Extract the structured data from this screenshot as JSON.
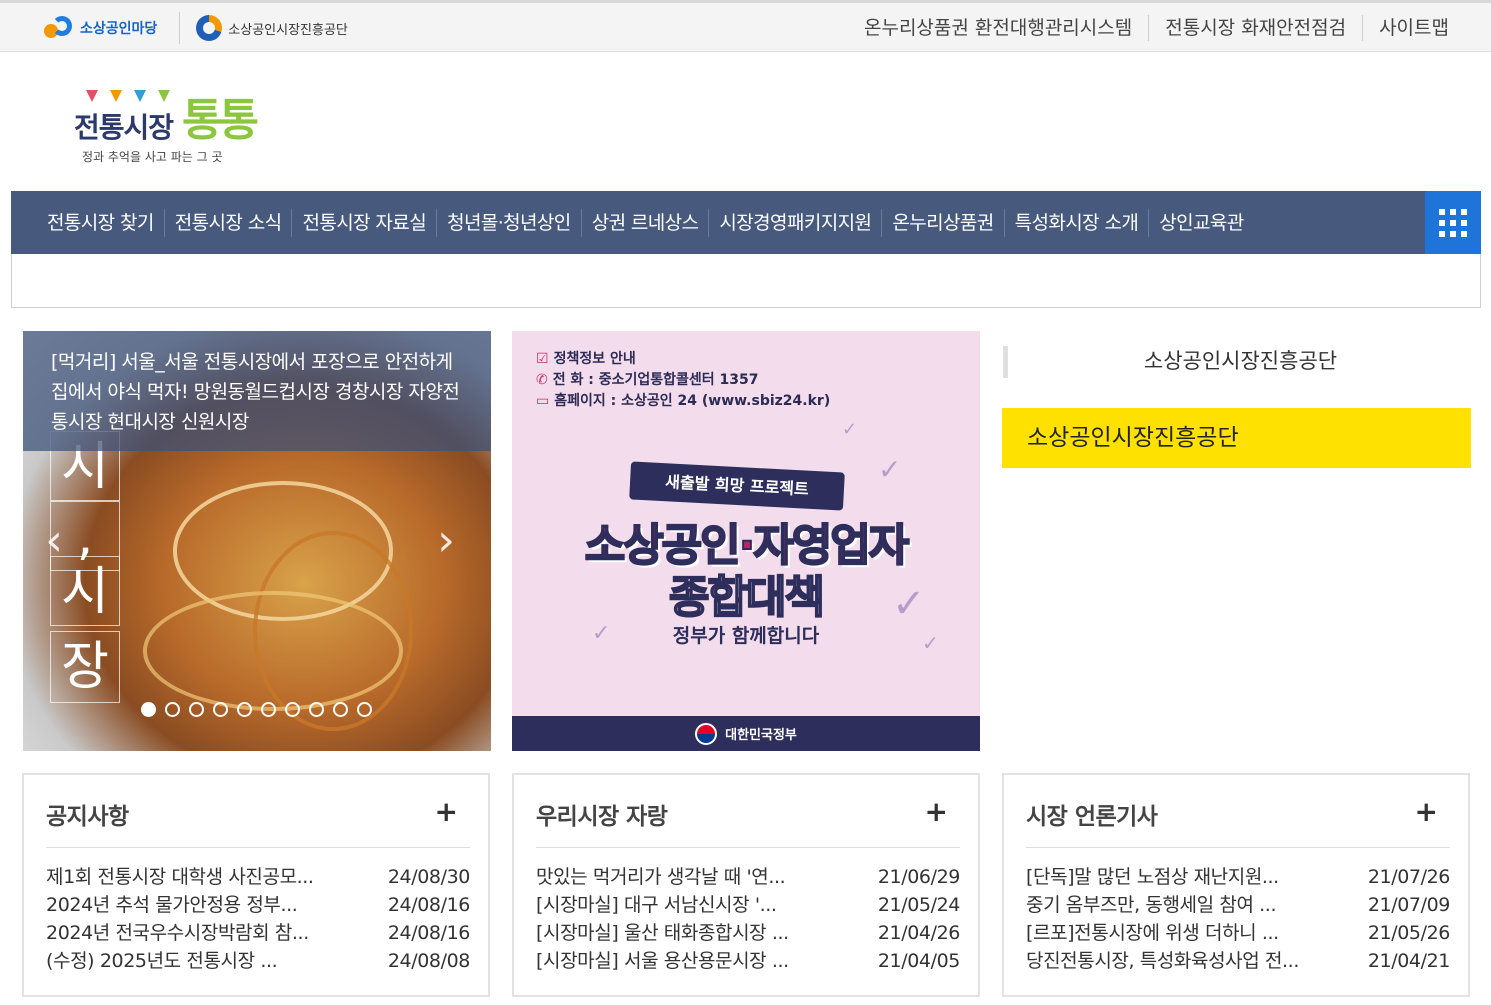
{
  "topbar": {
    "logo_a": "소상공인마당",
    "logo_b": "소상공인시장진흥공단",
    "links": [
      "온누리상품권 환전대행관리시스템",
      "전통시장 화재안전점검",
      "사이트맵"
    ]
  },
  "logo": {
    "title": "전통시장",
    "tong": "통통",
    "subtitle": "정과 추억을 사고 파는 그 곳"
  },
  "nav": {
    "items": [
      "전통시장 찾기",
      "전통시장 소식",
      "전통시장 자료실",
      "청년몰·청년상인",
      "상권 르네상스",
      "시장경영패키지지원",
      "온누리상품권",
      "특성화시장 소개",
      "상인교육관"
    ]
  },
  "slider": {
    "caption": "[먹거리] 서울_서울 전통시장에서 포장으로 안전하게 집에서 야식 먹자! 망원동월드컵시장 경창시장 자양전통시장 현대시장 신원시장",
    "vertical_chars": [
      "시",
      ",",
      "시",
      "장"
    ],
    "prev": "‹",
    "next": "›",
    "slide_count": 10,
    "active_index": 0
  },
  "banner": {
    "info_title": "정책정보 안내",
    "info_phone_label": "전      화",
    "info_phone": "중소기업통합콜센터 1357",
    "info_web_label": "홈페이지",
    "info_web": "소상공인 24 (www.sbiz24.kr)",
    "pill": "새출발 희망 프로젝트",
    "headline_1": "소상공인·자영업자",
    "headline_2": "종합대책",
    "tagline": "정부가 함께합니다",
    "footer": "대한민국정부"
  },
  "org": {
    "label": "소상공인시장진흥공단",
    "yellow": "소상공인시장진흥공단"
  },
  "boards": [
    {
      "title": "공지사항",
      "plus": "+",
      "items": [
        {
          "title": "제1회 전통시장 대학생 사진공모...",
          "date": "24/08/30"
        },
        {
          "title": "2024년 추석 물가안정용 정부...",
          "date": "24/08/16"
        },
        {
          "title": "2024년 전국우수시장박람회 참...",
          "date": "24/08/16"
        },
        {
          "title": "(수정) 2025년도 전통시장 ...",
          "date": "24/08/08"
        }
      ]
    },
    {
      "title": "우리시장 자랑",
      "plus": "+",
      "items": [
        {
          "title": "맛있는 먹거리가 생각날 때 '연...",
          "date": "21/06/29"
        },
        {
          "title": "[시장마실] 대구 서남신시장 '...",
          "date": "21/05/24"
        },
        {
          "title": "[시장마실] 울산 태화종합시장 ...",
          "date": "21/04/26"
        },
        {
          "title": "[시장마실] 서울 용산용문시장 ...",
          "date": "21/04/05"
        }
      ]
    },
    {
      "title": "시장 언론기사",
      "plus": "+",
      "items": [
        {
          "title": "[단독]말 많던 노점상 재난지원...",
          "date": "21/07/26"
        },
        {
          "title": "중기 옴부즈만, 동행세일 참여 ...",
          "date": "21/07/09"
        },
        {
          "title": "[르포]전통시장에 위생 더하니 ...",
          "date": "21/05/26"
        },
        {
          "title": "당진전통시장, 특성화육성사업 전...",
          "date": "21/04/21"
        }
      ]
    }
  ]
}
